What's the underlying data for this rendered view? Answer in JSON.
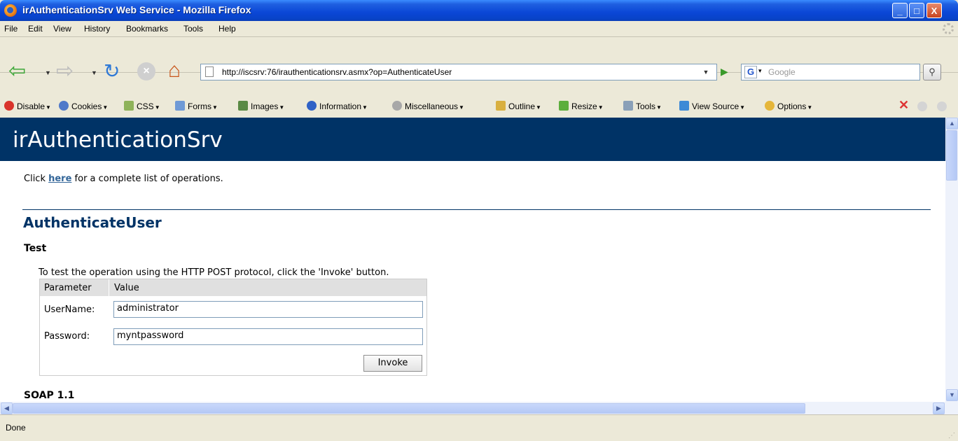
{
  "window": {
    "title": "irAuthenticationSrv Web Service - Mozilla Firefox",
    "controls": {
      "minimize": "_",
      "maximize": "□",
      "close": "X"
    }
  },
  "menu": [
    "File",
    "Edit",
    "View",
    "History",
    "Bookmarks",
    "Tools",
    "Help"
  ],
  "nav": {
    "url": "http://iscsrv:76/irauthenticationsrv.asmx?op=AuthenticateUser",
    "search_placeholder": "Google",
    "search_engine": "G"
  },
  "devbar": [
    {
      "label": "Disable",
      "icon": "disable-icon",
      "color": "#d9342b"
    },
    {
      "label": "Cookies",
      "icon": "cookies-icon",
      "color": "#4f79c9"
    },
    {
      "label": "CSS",
      "icon": "css-icon",
      "color": "#8fb35a"
    },
    {
      "label": "Forms",
      "icon": "forms-icon",
      "color": "#6f9ad6"
    },
    {
      "label": "Images",
      "icon": "images-icon",
      "color": "#5a8a44"
    },
    {
      "label": "Information",
      "icon": "information-icon",
      "color": "#2f62c6"
    },
    {
      "label": "Miscellaneous",
      "icon": "miscellaneous-icon",
      "color": "#a8a8a8"
    },
    {
      "label": "Outline",
      "icon": "outline-icon",
      "color": "#d9b040"
    },
    {
      "label": "Resize",
      "icon": "resize-icon",
      "color": "#5cae3c"
    },
    {
      "label": "Tools",
      "icon": "tools-icon",
      "color": "#8aa0b8"
    },
    {
      "label": "View Source",
      "icon": "view-source-icon",
      "color": "#3d8ad6"
    },
    {
      "label": "Options",
      "icon": "options-icon",
      "color": "#e5b63a"
    }
  ],
  "page": {
    "title": "irAuthenticationSrv",
    "intro_before": "Click ",
    "intro_link": "here",
    "intro_after": " for a complete list of operations.",
    "operation": "AuthenticateUser",
    "test_heading": "Test",
    "test_desc": "To test the operation using the HTTP POST protocol, click the 'Invoke' button.",
    "table": {
      "col_parameter": "Parameter",
      "col_value": "Value",
      "rows": [
        {
          "label": "UserName:",
          "value": "administrator"
        },
        {
          "label": "Password:",
          "value": "myntpassword"
        }
      ],
      "invoke": "Invoke"
    },
    "soap_heading": "SOAP 1.1"
  },
  "status": "Done",
  "colors": {
    "header": "#003366",
    "link": "#336699",
    "titlebar": "#0A46D6"
  }
}
